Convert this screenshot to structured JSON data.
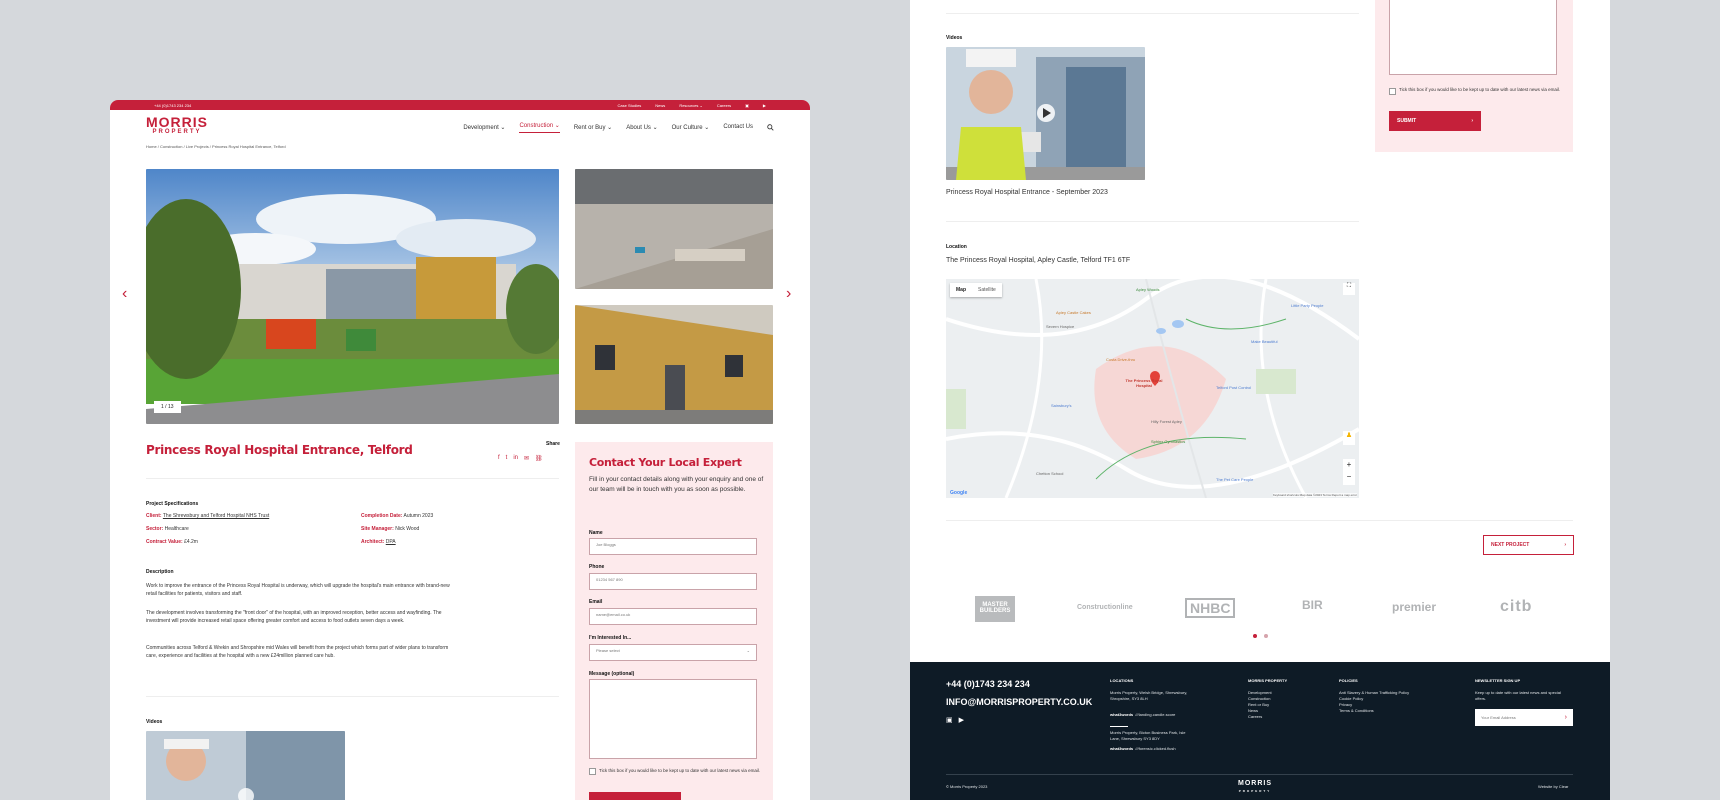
{
  "header": {
    "phone": "+44 (0)1743 234 234",
    "top_links": [
      "Case Studies",
      "News",
      "Resources ⌄",
      "Careers"
    ],
    "logo_line1": "MORRIS",
    "logo_line2": "PROPERTY",
    "menu": [
      "Development ⌄",
      "Construction ⌄",
      "Rent or Buy ⌄",
      "About Us ⌄",
      "Our Culture ⌄",
      "Contact Us"
    ]
  },
  "breadcrumb": "Home / Construction / Live Projects / Princess Royal Hospital Entrance, Telford",
  "gallery": {
    "counter": "1 / 13"
  },
  "project": {
    "title": "Princess Royal Hospital Entrance, Telford",
    "share_label": "Share",
    "specs_heading": "Project Specifications",
    "specs": [
      {
        "label": "Client:",
        "value": "The Shrewsbury and Telford Hospital NHS Trust"
      },
      {
        "label": "Completion Date:",
        "value": "Autumn 2023"
      },
      {
        "label": "Sector:",
        "value": "Healthcare"
      },
      {
        "label": "Site Manager:",
        "value": "Nick Wood"
      },
      {
        "label": "Contract Value:",
        "value": "£4.2m"
      },
      {
        "label": "Architect:",
        "value": "DPA"
      }
    ],
    "description_heading": "Description",
    "description": [
      "Work to improve the entrance of the Princess Royal Hospital is underway, which will upgrade the hospital's main entrance with brand-new retail facilities for patients, visitors and staff.",
      "The development involves transforming the \"front door\" of the hospital, with an improved reception, better access and wayfinding. The investment will provide increased retail space offering greater comfort and access to food outlets seven days a week.",
      "Communities across Telford & Wrekin and Shropshire mid Wales will benefit from the project which forms part of wider plans to transform care, experience and facilities at the hospital with a new £24million planned care hub."
    ],
    "videos_heading": "Videos",
    "video_caption": "Princess Royal Hospital Entrance - September 2023",
    "location_heading": "Location",
    "location_address": "The Princess Royal Hospital, Apley Castle, Telford TF1 6TF",
    "next_project": "NEXT PROJECT"
  },
  "form": {
    "title": "Contact Your Local Expert",
    "intro": "Fill in your contact details along with your enquiry and one of our team will be in touch with you as soon as possible.",
    "name_label": "Name",
    "name_placeholder": "Joe Bloggs",
    "phone_label": "Phone",
    "phone_placeholder": "01234 567 890",
    "email_label": "Email",
    "email_placeholder": "name@email.co.uk",
    "interest_label": "I'm Interested In...",
    "interest_placeholder": "Please select",
    "message_label": "Message (optional)",
    "checkbox_text": "Tick this box if you would like to be kept up to date with our latest news via email.",
    "submit": "SUBMIT"
  },
  "map": {
    "tabs": [
      "Map",
      "Satellite"
    ],
    "pin_label": "The Princess Royal Hospital",
    "places": [
      "Apley Woods",
      "Apley Castle Cakes",
      "Severn Hospice",
      "Costa Drive-thru",
      "Telford Post Control",
      "Sainsbury's",
      "Sphinx Gymnastics",
      "Chetton School",
      "The Pet Care People",
      "Make Beautiful",
      "Little Party People",
      "Hilly Forest Apley"
    ],
    "footer": "Keyboard shortcuts   Map data ©2023   Terms   Report a map error"
  },
  "partners": [
    "MASTER BUILDERS",
    "Constructionline",
    "NHBC",
    "BIR",
    "premier",
    "citb"
  ],
  "footer": {
    "phone": "+44 (0)1743 234 234",
    "email": "INFO@MORRISPROPERTY.CO.UK",
    "locations_heading": "LOCATIONS",
    "location1": "Morris Property, Welsh Bridge, Shrewsbury, Shropshire, SY3 8LH",
    "w3w1_label": "what3words",
    "w3w1": "///landing.candle.score",
    "location2": "Morris Property, Bicton Business Park, Isle Lane, Shrewsbury SY3 8DY",
    "w3w2_label": "what3words",
    "w3w2": "///forensic.clicked.flush",
    "col_heading": "MORRIS PROPERTY",
    "col_links": [
      "Development",
      "Construction",
      "Rent or Buy",
      "News",
      "Careers"
    ],
    "policies_heading": "POLICIES",
    "policies": [
      "Anti Slavery & Human Trafficking Policy",
      "Cookie Policy",
      "Privacy",
      "Terms & Conditions"
    ],
    "newsletter_heading": "NEWSLETTER SIGN UP",
    "newsletter_text": "Keep up to date with our latest news and special offers.",
    "newsletter_placeholder": "Your Email Address",
    "copyright": "© Morris Property 2023",
    "credit": "Website by Clear"
  }
}
